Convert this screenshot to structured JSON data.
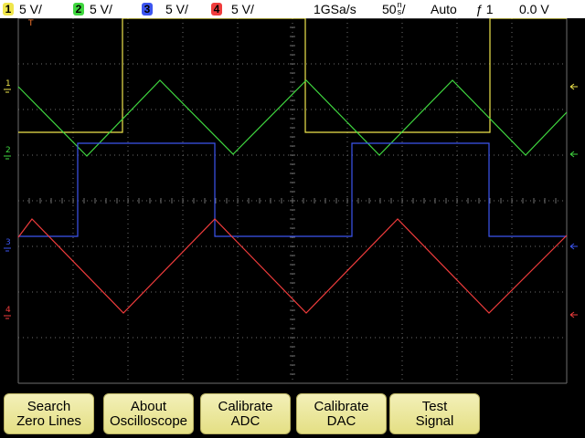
{
  "status": {
    "channels": [
      {
        "num": "1",
        "scale": "5 V/",
        "color": "#f0e64c"
      },
      {
        "num": "2",
        "scale": "5 V/",
        "color": "#3fd63f"
      },
      {
        "num": "3",
        "scale": "5 V/",
        "color": "#3c55f0"
      },
      {
        "num": "4",
        "scale": "5 V/",
        "color": "#f03c3c"
      }
    ],
    "sample_rate": "1GSa/s",
    "timebase_value": "50",
    "timebase_unit_top": "n",
    "timebase_unit_bottom": "s",
    "timebase_unit_suffix": "/",
    "trigger_mode": "Auto",
    "trigger_icon": "trigger-rising-edge-icon",
    "trigger_glyph": "ƒ",
    "trigger_source": "1",
    "trigger_level": "0.0 V"
  },
  "markers": {
    "left": [
      "1",
      "2",
      "3",
      "4"
    ],
    "trigger_top": "T"
  },
  "softkeys": [
    {
      "line1": "Search",
      "line2": "Zero Lines"
    },
    {
      "line1": "About",
      "line2": "Oscilloscope"
    },
    {
      "line1": "Calibrate",
      "line2": "ADC"
    },
    {
      "line1": "Calibrate",
      "line2": "DAC"
    },
    {
      "line1": "Test",
      "line2": "Signal"
    }
  ],
  "colors": {
    "ch1": "#f0e64c",
    "ch2": "#3fd63f",
    "ch3": "#3c55f0",
    "ch4": "#f03c3c",
    "grid": "#6e6e6e",
    "softkey": "#ece79e"
  }
}
